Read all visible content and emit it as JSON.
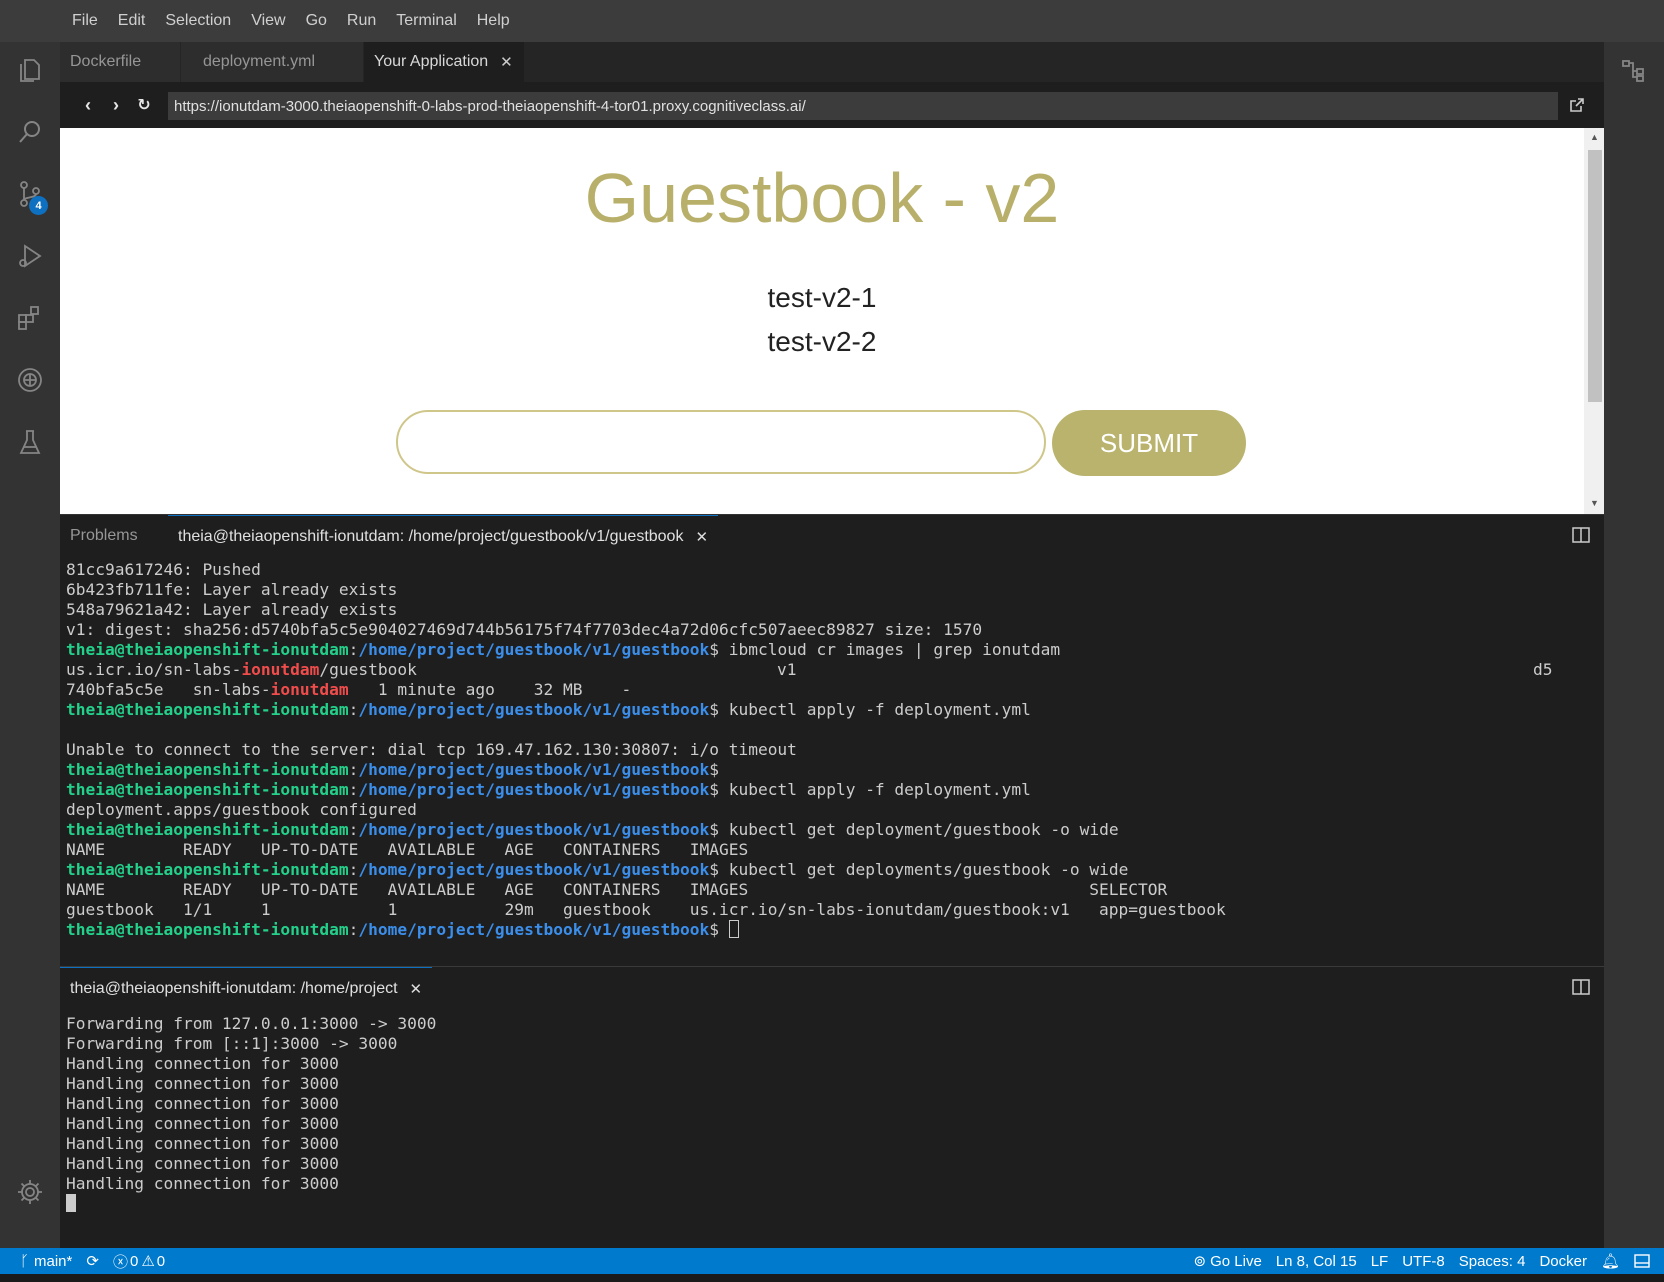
{
  "menu": [
    "File",
    "Edit",
    "Selection",
    "View",
    "Go",
    "Run",
    "Terminal",
    "Help"
  ],
  "editor_tabs": [
    {
      "label": "Dockerfile",
      "active": false
    },
    {
      "label": "deployment.yml",
      "active": false
    },
    {
      "label": "Your Application",
      "active": true
    }
  ],
  "browser": {
    "url": "https://ionutdam-3000.theiaopenshift-0-labs-prod-theiaopenshift-4-tor01.proxy.cognitiveclass.ai/"
  },
  "guestbook": {
    "title": "Guestbook - v2",
    "entries": [
      "test-v2-1",
      "test-v2-2"
    ],
    "input_value": "",
    "submit_label": "SUBMIT",
    "accent_color": "#b9b36d"
  },
  "activity_bar": {
    "icons": [
      "explorer-icon",
      "search-icon",
      "source-control-icon",
      "run-debug-icon",
      "extensions-icon",
      "remote-icon",
      "testing-icon",
      "settings-gear-icon"
    ],
    "scm_badge": "4"
  },
  "panel1": {
    "tabs": [
      "Problems",
      "theia@theiaopenshift-ionutdam: /home/project/guestbook/v1/guestbook"
    ],
    "prompt_user": "theia@theiaopenshift-ionutdam",
    "prompt_path": "/home/project/guestbook/v1/guestbook",
    "lines": [
      "81cc9a617246: Pushed",
      "6b423fb711fe: Layer already exists",
      "548a79621a42: Layer already exists",
      "v1: digest: sha256:d5740bfa5c5e904027469d744b56175f74f7703dec4a72d06cfc507aeec89827 size: 1570",
      "ibmcloud cr images | grep ionutdam",
      "kubectl apply -f deployment.yml",
      "Unable to connect to the server: dial tcp 169.47.162.130:30807: i/o timeout",
      "kubectl apply -f deployment.yml",
      "deployment.apps/guestbook configured",
      "kubectl get deployment/guestbook -o wide",
      "NAME        READY   UP-TO-DATE   AVAILABLE   AGE   CONTAINERS   IMAGES",
      "kubectl get deployments/guestbook -o wide",
      "NAME        READY   UP-TO-DATE   AVAILABLE   AGE   CONTAINERS   IMAGES                                   SELECTOR",
      "guestbook   1/1     1            1           29m   guestbook    us.icr.io/sn-labs-ionutdam/guestbook:v1   app=guestbook"
    ],
    "image_row": {
      "pre": "us.icr.io/sn-labs-",
      "user": "ionutdam",
      "post": "/guestbook",
      "tag": "v1",
      "trunc": "d5"
    },
    "id_row": {
      "pre": "740bfa5c5e   sn-labs-",
      "user": "ionutdam",
      "post": "   1 minute ago    32 MB    -"
    }
  },
  "panel2": {
    "tab": "theia@theiaopenshift-ionutdam: /home/project",
    "lines": [
      "Forwarding from 127.0.0.1:3000 -> 3000",
      "Forwarding from [::1]:3000 -> 3000",
      "Handling connection for 3000",
      "Handling connection for 3000",
      "Handling connection for 3000",
      "Handling connection for 3000",
      "Handling connection for 3000",
      "Handling connection for 3000",
      "Handling connection for 3000"
    ]
  },
  "status": {
    "branch": "main*",
    "errors": "0",
    "warnings": "0",
    "go_live": "Go Live",
    "position": "Ln 8, Col 15",
    "eol": "LF",
    "encoding": "UTF-8",
    "spaces": "Spaces: 4",
    "language": "Docker"
  },
  "colors": {
    "status_bar": "#007acc",
    "prompt_user": "#23d18b",
    "prompt_path": "#3b8eea",
    "highlight": "#f14c4c"
  }
}
